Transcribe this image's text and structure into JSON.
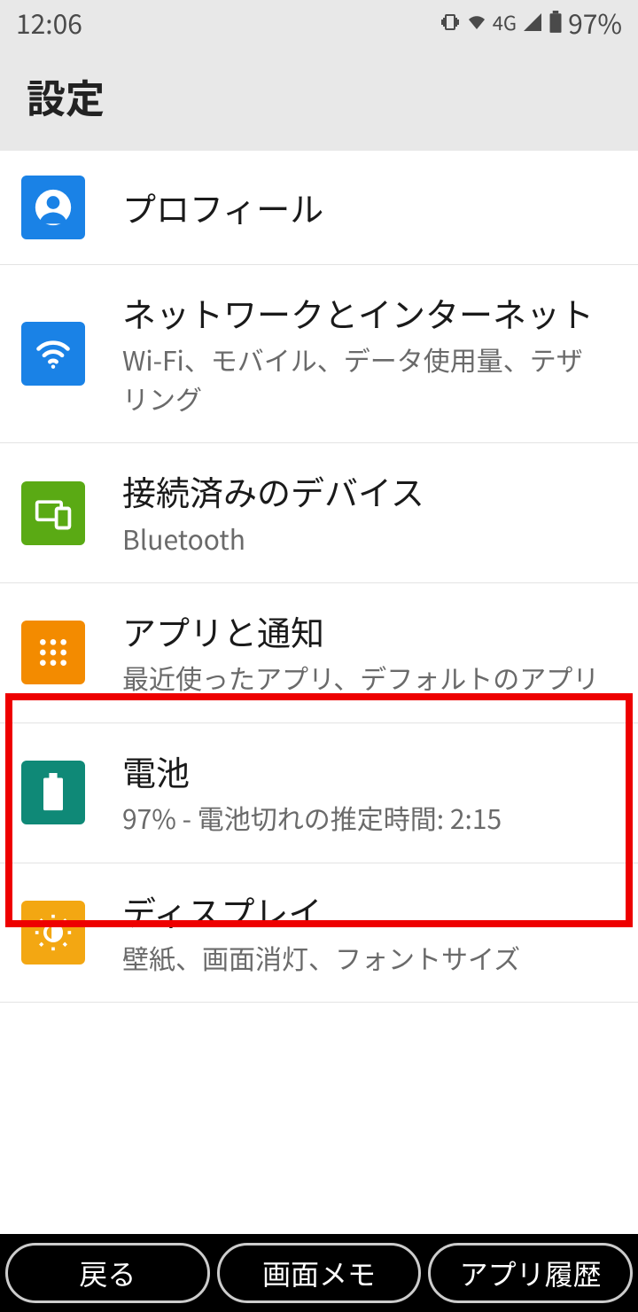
{
  "status": {
    "time": "12:06",
    "network": "4G",
    "battery_pct": "97%"
  },
  "header": {
    "title": "設定"
  },
  "items": [
    {
      "title": "プロフィール",
      "sub": ""
    },
    {
      "title": "ネットワークとインターネット",
      "sub": "Wi-Fi、モバイル、データ使用量、テザリング"
    },
    {
      "title": "接続済みのデバイス",
      "sub": "Bluetooth"
    },
    {
      "title": "アプリと通知",
      "sub": "最近使ったアプリ、デフォルトのアプリ"
    },
    {
      "title": "電池",
      "sub": "97% - 電池切れの推定時間: 2:15"
    },
    {
      "title": "ディスプレイ",
      "sub": "壁紙、画面消灯、フォントサイズ"
    }
  ],
  "nav": {
    "back": "戻る",
    "screen_memo": "画面メモ",
    "app_history": "アプリ履歴"
  },
  "highlighted_index": 3
}
